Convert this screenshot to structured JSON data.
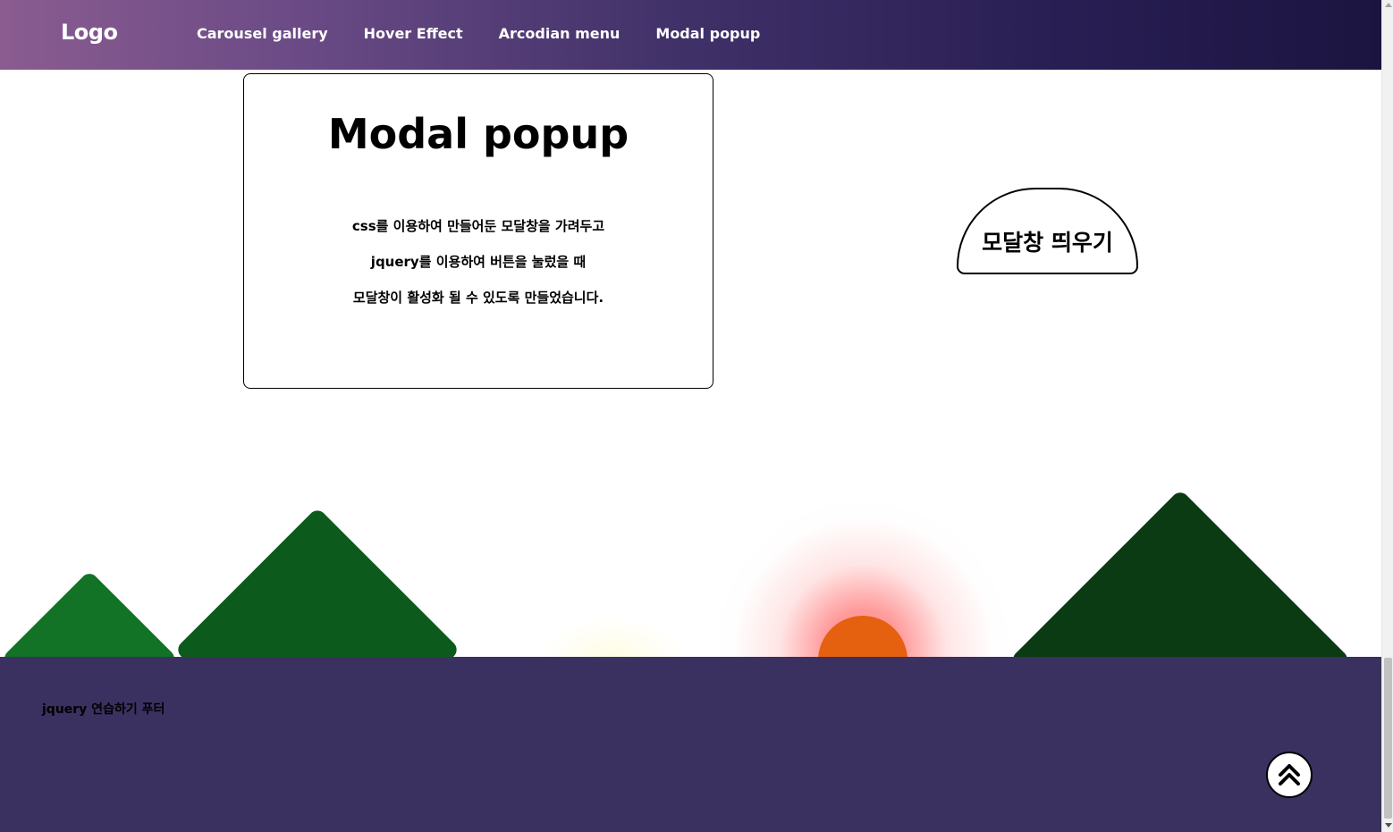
{
  "header": {
    "logo": "Logo",
    "nav": [
      {
        "label": "Carousel gallery"
      },
      {
        "label": "Hover Effect"
      },
      {
        "label": "Arcodian menu"
      },
      {
        "label": "Modal popup"
      }
    ]
  },
  "modal_card": {
    "title": "Modal popup",
    "lines": [
      "css를 이용하여 만들어둔 모달창을 가려두고",
      "jquery를 이용하여 버튼을 눌렀을 때",
      "모달창이 활성화 될 수 있도록 만들었습니다."
    ]
  },
  "open_button": {
    "label": "모달창 띄우기"
  },
  "footer": {
    "text": "jquery 연습하기 푸터",
    "top_button_icon": "double-chevron-up-icon"
  },
  "colors": {
    "header_gradient": [
      "#8a5c90",
      "#3f3068",
      "#1b1440"
    ],
    "footer_bg": "#3a3160",
    "sun": "#e5600f",
    "mountain_left": "#127225",
    "mountain_mid": "#0c5b1d",
    "mountain_right": "#0b3b13"
  }
}
